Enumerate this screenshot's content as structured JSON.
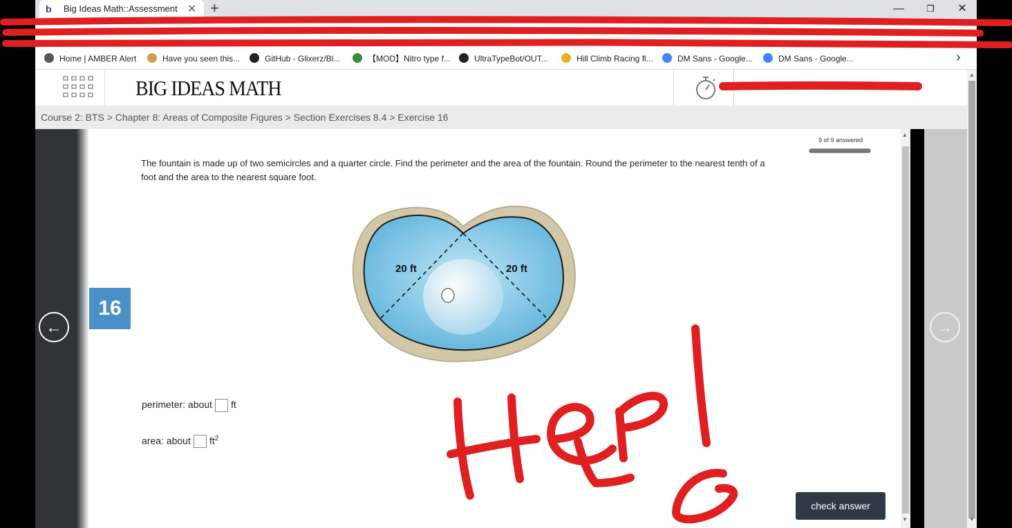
{
  "browser": {
    "tab_title": "Big Ideas Math::Assessment",
    "tab_favicon": "b",
    "new_tab": "+",
    "minimize": "—",
    "maximize": "❐",
    "close": "✕",
    "bookmarks": [
      {
        "label": "Home | AMBER Alert",
        "icon": "amber-alert-icon",
        "color": "#555555"
      },
      {
        "label": "Have you seen this...",
        "icon": "people-icon",
        "color": "#c8a050"
      },
      {
        "label": "GitHub - Glixerz/Bl...",
        "icon": "github-icon",
        "color": "#222222"
      },
      {
        "label": "【MOD】Nitro type f...",
        "icon": "nitro-icon",
        "color": "#3a8a3a"
      },
      {
        "label": "UltraTypeBot/OUT...",
        "icon": "github-icon",
        "color": "#222222"
      },
      {
        "label": "Hill Climb Racing fl...",
        "icon": "coin-icon",
        "color": "#e8b020"
      },
      {
        "label": "DM Sans - Google...",
        "icon": "google-fonts-icon",
        "color": "#4285f4"
      },
      {
        "label": "DM Sans - Google...",
        "icon": "google-fonts-icon",
        "color": "#4285f4"
      }
    ],
    "bookmarks_more": "›"
  },
  "header": {
    "logo": "BIG IDEAS MATH",
    "menu_icon": "grid-menu-icon",
    "timer_icon": "stopwatch-icon"
  },
  "breadcrumb": "Course 2: BTS > Chapter 8: Areas of Composite Figures > Section Exercises 8.4 > Exercise 16",
  "nav": {
    "prev": "←",
    "next": "→"
  },
  "assessment": {
    "answered": "9 of 9 answered",
    "progress": 1.0,
    "exercise_number": "16",
    "problem": "The fountain is made up of two semicircles and a quarter circle. Find the perimeter and the area of the fountain. Round the perimeter to the nearest tenth of a foot and the area to the nearest square foot.",
    "figure": {
      "left_label": "20 ft",
      "right_label": "20 ft"
    },
    "perimeter_label": "perimeter: about",
    "perimeter_unit": "ft",
    "perimeter_value": "",
    "area_label": "area: about",
    "area_unit": "ft",
    "area_unit_exp": "2",
    "area_value": "",
    "check_button": "check answer"
  },
  "annotation": {
    "text": "Help",
    "color": "#e02020"
  }
}
